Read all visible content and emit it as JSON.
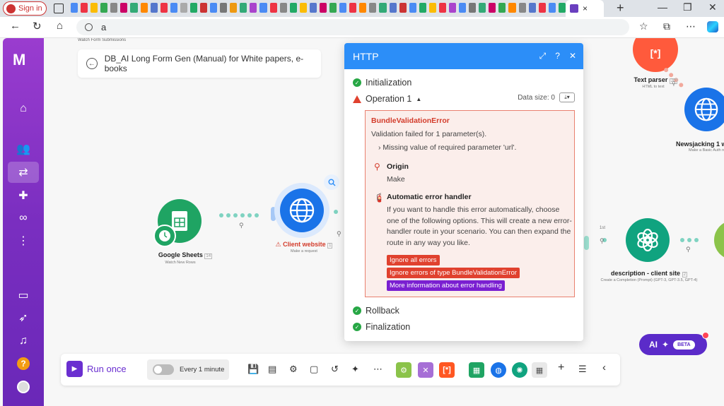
{
  "browser": {
    "signin_label": "Sign in",
    "address_value": "a",
    "tab_close": "×",
    "new_tab": "+",
    "window_controls": [
      "—",
      "❐",
      "✕"
    ],
    "favicon_colors": [
      "#4b8bf4",
      "#e34",
      "#fbbc05",
      "#34a853",
      "#888",
      "#c06",
      "#3a7",
      "#f80",
      "#57c",
      "#e34",
      "#4b8bf4",
      "#aaa",
      "#2a6",
      "#c33",
      "#4b8bf4",
      "#777",
      "#e91",
      "#3a7",
      "#a4c",
      "#4b8bf4",
      "#e34",
      "#888",
      "#2a6",
      "#fbbc05",
      "#57c",
      "#c06",
      "#34a853",
      "#4b8bf4",
      "#e34",
      "#f80",
      "#888",
      "#3a7",
      "#57c",
      "#c33",
      "#4b8bf4",
      "#2a6",
      "#fbbc05",
      "#e34",
      "#a4c",
      "#4b8bf4",
      "#777",
      "#3a7",
      "#c06",
      "#34a853",
      "#f80",
      "#888",
      "#57c",
      "#e34",
      "#4b8bf4",
      "#2a6"
    ]
  },
  "sidebar": {
    "logo": "M",
    "icons": [
      "home-icon",
      "users-icon",
      "share-icon",
      "puzzle-icon",
      "link-icon",
      "more-icon",
      "book-icon",
      "rocket-icon",
      "bell-icon"
    ],
    "help": "?"
  },
  "canvas": {
    "header_sublabel": "Watch Form Submissions",
    "scenario_title": "DB_AI Long Form Gen (Manual) for White papers, e-books",
    "modules": {
      "google_sheets": {
        "label": "Google Sheets",
        "badge": "14",
        "sub": "Watch New Rows"
      },
      "client_website": {
        "label": "Client website",
        "badge": "1",
        "sub": "Make a request"
      },
      "text_parser": {
        "label": "Text parser",
        "badge": "20",
        "sub": "HTML to text"
      },
      "newsjacking": {
        "label": "Newsjacking 1 w",
        "sub": "Make a Basic Auth re"
      },
      "description": {
        "label": "description - client site",
        "badge": "2",
        "sub": "Create a Completion (Prompt) (GPT-3, GPT-3.5, GPT-4)"
      },
      "route_label": "1st"
    }
  },
  "modal": {
    "title": "HTTP",
    "steps": {
      "initialization": "Initialization",
      "operation": "Operation 1",
      "rollback": "Rollback",
      "finalization": "Finalization"
    },
    "data_size_label": "Data size: 0",
    "error": {
      "name": "BundleValidationError",
      "message": "Validation failed for 1 parameter(s).",
      "detail": "Missing value of required parameter 'url'.",
      "origin_title": "Origin",
      "origin_value": "Make",
      "handler_title": "Automatic error handler",
      "handler_body": "If you want to handle this error automatically, choose one of the following options. This will create a new error-handler route in your scenario. You can then expand the route in any way you like.",
      "buttons": {
        "ignore_all": "Ignore all errors",
        "ignore_type": "Ignore errors of type BundleValidationError",
        "more_info": "More information about error handling"
      }
    },
    "colors": {
      "header": "#2c8ef8",
      "error": "#d33b2a",
      "ok": "#27a745",
      "more_info": "#7a1fd1"
    }
  },
  "toolbar": {
    "run_once": "Run once",
    "schedule": "Every 1 minute",
    "app_colors": [
      "#8bc34a",
      "#a66fd6",
      "#ff5722",
      "#1fa463",
      "#1a73e8",
      "#10a37f"
    ]
  },
  "ai": {
    "label": "AI",
    "badge": "BETA"
  }
}
